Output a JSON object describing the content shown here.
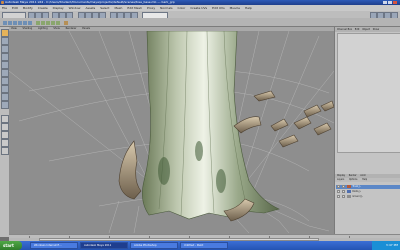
{
  "app": {
    "title": "Autodesk Maya 2011 x64 - C:/Users/Student/Documents/maya/projects/default/scenes/tree_base.mb   ---   bark_grp",
    "accent": "#2d5bb8"
  },
  "menubar": [
    "File",
    "Edit",
    "Modify",
    "Create",
    "Display",
    "Window",
    "Assets",
    "Select",
    "Mesh",
    "Edit Mesh",
    "Proxy",
    "Normals",
    "Color",
    "Create UVs",
    "Edit UVs",
    "Muscle",
    "Help"
  ],
  "viewport": {
    "menu": [
      "View",
      "Shading",
      "Lighting",
      "Show",
      "Renderer",
      "Panels"
    ]
  },
  "right_panel": {
    "tabs": [
      "Channel Box",
      "Edit",
      "Object",
      "Show"
    ],
    "layer_tabs": [
      "Display",
      "Render",
      "Anim"
    ],
    "layer_sub": [
      "Layers",
      "Options",
      "Help"
    ],
    "layers": [
      {
        "name": "Trunk_L",
        "color": "#b35a3a"
      },
      {
        "name": "Roots_L",
        "color": "#4f6fb0"
      },
      {
        "name": "Ground_L",
        "color": "#8d8d8d"
      }
    ]
  },
  "taskbar": {
    "start": "start",
    "tasks": [
      "Windows Internet E...",
      "Autodesk Maya 2011",
      "Adobe Photoshop",
      "Untitled - Paint"
    ],
    "clock": "3:47 PM"
  }
}
